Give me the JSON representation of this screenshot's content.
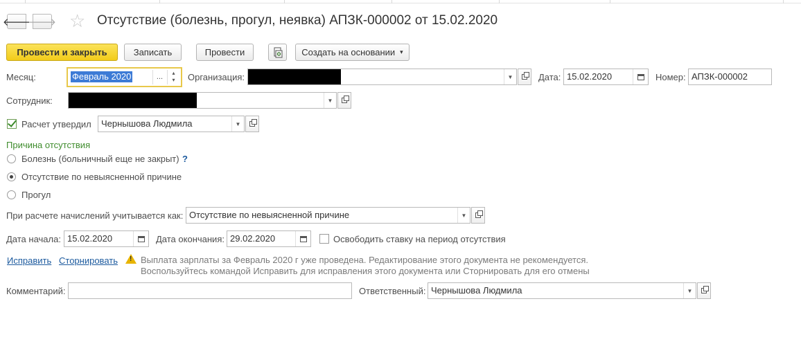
{
  "header": {
    "back_glyph": "🡐",
    "forward_glyph": "🡒",
    "star_glyph": "☆",
    "title": "Отсутствие (болезнь, прогул, неявка) АПЗК-000002 от 15.02.2020"
  },
  "toolbar": {
    "post_close_label": "Провести и закрыть",
    "write_label": "Записать",
    "post_label": "Провести",
    "create_based_label": "Создать на основании",
    "caret": "▾"
  },
  "form": {
    "month_label": "Месяц:",
    "month_value": "Февраль 2020",
    "month_dots": "...",
    "month_up": "▴",
    "month_down": "▾",
    "org_label": "Организация:",
    "date_label": "Дата:",
    "date_value": "15.02.2020",
    "number_label": "Номер:",
    "number_value": "АПЗК-000002",
    "employee_label": "Сотрудник:",
    "approved_label": "Расчет утвердил",
    "approved_checked": true,
    "approver_value": "Чернышова Людмила",
    "reason_header": "Причина отсутствия",
    "reasons": [
      {
        "label": "Болезнь (больничный еще не закрыт)",
        "selected": false,
        "help": "?"
      },
      {
        "label": "Отсутствие по невыясненной причине",
        "selected": true
      },
      {
        "label": "Прогул",
        "selected": false
      }
    ],
    "accrual_label": "При расчете начислений учитывается как:",
    "accrual_value": "Отсутствие по невыясненной причине",
    "start_label": "Дата начала:",
    "start_value": "15.02.2020",
    "end_label": "Дата окончания:",
    "end_value": "29.02.2020",
    "release_rate_label": "Освободить ставку на период отсутствия",
    "release_rate_checked": false,
    "fix_link": "Исправить",
    "storno_link": "Сторнировать",
    "warning_line1": "Выплата зарплаты за Февраль 2020 г уже проведена. Редактирование этого документа не рекомендуется.",
    "warning_line2": "Воспользуйтесь командой Исправить для исправления этого документа или Сторнировать для его отмены",
    "comment_label": "Комментарий:",
    "comment_value": "",
    "responsible_label": "Ответственный:",
    "responsible_value": "Чернышова Людмила"
  },
  "colors": {
    "primary_button": "#f2cc1a",
    "section_header": "#3f8c2d",
    "link": "#1c5a9e",
    "warning": "#e8b400",
    "focus_border": "#e8c84a"
  }
}
